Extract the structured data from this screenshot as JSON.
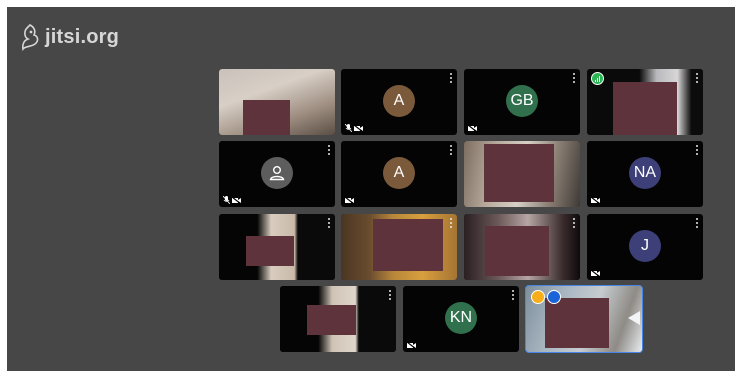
{
  "app": {
    "logo_text": "jitsi.org"
  },
  "colors": {
    "stage_bg": "#474747",
    "tile_bg": "#040404",
    "redaction": "#5e333c",
    "active_border": "#4687e6"
  },
  "tiles": [
    {
      "id": "r1c1",
      "type": "video",
      "muted": false,
      "video_off": false
    },
    {
      "id": "r1c2",
      "type": "avatar",
      "initials": "A",
      "avatar_color": "#7b5a3c",
      "muted": true,
      "video_off": true
    },
    {
      "id": "r1c3",
      "type": "avatar",
      "initials": "GB",
      "avatar_color": "#30704d",
      "muted": false,
      "video_off": true
    },
    {
      "id": "r1c4",
      "type": "video",
      "connection_indicator": true,
      "muted": false,
      "video_off": false
    },
    {
      "id": "r2c1",
      "type": "avatar-default",
      "initials": "",
      "avatar_color": "#5d5d5d",
      "muted": true,
      "video_off": true
    },
    {
      "id": "r2c2",
      "type": "avatar",
      "initials": "A",
      "avatar_color": "#7b5a3c",
      "muted": false,
      "video_off": true
    },
    {
      "id": "r2c3",
      "type": "video",
      "muted": false,
      "video_off": false
    },
    {
      "id": "r2c4",
      "type": "avatar",
      "initials": "NA",
      "avatar_color": "#3d4078",
      "muted": false,
      "video_off": true
    },
    {
      "id": "r3c1",
      "type": "video",
      "muted": false,
      "video_off": false
    },
    {
      "id": "r3c2",
      "type": "video",
      "muted": false,
      "video_off": false
    },
    {
      "id": "r3c3",
      "type": "video",
      "muted": false,
      "video_off": false
    },
    {
      "id": "r3c4",
      "type": "avatar",
      "initials": "J",
      "avatar_color": "#3d4078",
      "muted": false,
      "video_off": true
    },
    {
      "id": "r4c1",
      "type": "video",
      "muted": false,
      "video_off": false
    },
    {
      "id": "r4c2",
      "type": "avatar",
      "initials": "KN",
      "avatar_color": "#30704d",
      "muted": false,
      "video_off": true
    },
    {
      "id": "r4c3",
      "type": "video",
      "active_speaker": true,
      "raised_hand": true,
      "muted": false,
      "video_off": false
    }
  ]
}
